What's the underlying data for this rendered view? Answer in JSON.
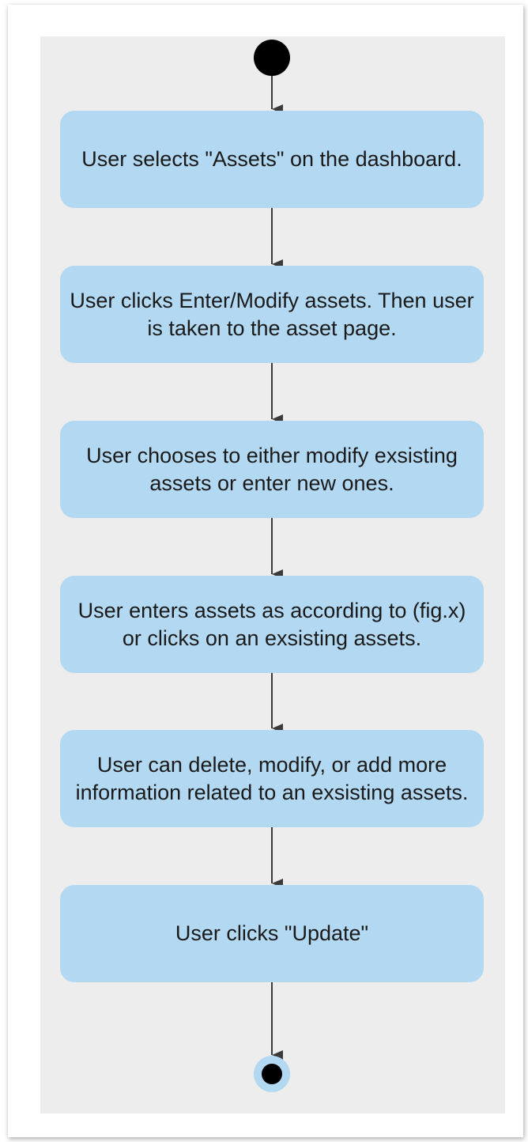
{
  "diagram": {
    "type": "activity-flow",
    "steps": [
      {
        "text": "User selects \"Assets\" on the dashboard."
      },
      {
        "text": "User clicks Enter/Modify assets. Then user is taken to the asset page."
      },
      {
        "text": "User chooses to either modify exsisting assets or enter new ones."
      },
      {
        "text": "User enters assets as according to (fig.x) or clicks on an exsisting assets."
      },
      {
        "text": "User can delete, modify, or add more information related to an exsisting assets."
      },
      {
        "text": "User clicks \"Update\""
      }
    ]
  },
  "colors": {
    "canvas": "#ededed",
    "step_fill": "#b3d8f2",
    "node": "#000000",
    "end_ring": "#b3d8f2",
    "connector": "#3a3a3a"
  }
}
